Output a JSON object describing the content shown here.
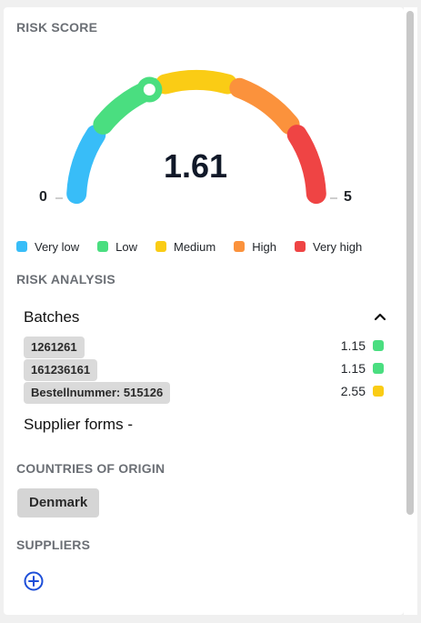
{
  "risk_score": {
    "title": "RISK SCORE",
    "score": "1.61",
    "min_label": "0",
    "max_label": "5",
    "needle_segment": "Low"
  },
  "legend": [
    {
      "label": "Very low",
      "color": "#38bdf8"
    },
    {
      "label": "Low",
      "color": "#4ade80"
    },
    {
      "label": "Medium",
      "color": "#facc15"
    },
    {
      "label": "High",
      "color": "#fb923c"
    },
    {
      "label": "Very high",
      "color": "#ef4444"
    }
  ],
  "risk_analysis": {
    "title": "RISK ANALYSIS",
    "batches_label": "Batches",
    "batches": [
      {
        "id": "1261261",
        "value": "1.15",
        "color": "#4ade80"
      },
      {
        "id": "161236161",
        "value": "1.15",
        "color": "#4ade80"
      },
      {
        "id": "Bestellnummer: 515126",
        "value": "2.55",
        "color": "#facc15"
      }
    ],
    "supplier_forms_label": "Supplier forms -"
  },
  "countries": {
    "title": "COUNTRIES OF ORIGIN",
    "items": [
      "Denmark"
    ]
  },
  "suppliers": {
    "title": "SUPPLIERS",
    "add_icon": "plus-circle-icon"
  }
}
